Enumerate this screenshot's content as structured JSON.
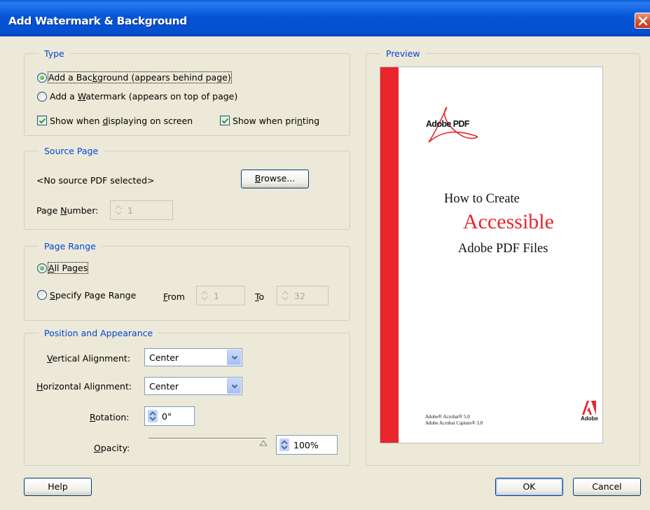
{
  "window": {
    "title": "Add Watermark & Background",
    "close_icon": "close-icon"
  },
  "type_group": {
    "legend": "Type",
    "radio_background": {
      "label_pre": "Add a Bac",
      "label_key": "k",
      "label_post": "ground (appears behind page)",
      "selected": true
    },
    "radio_watermark": {
      "label_pre": "Add a ",
      "label_key": "W",
      "label_post": "atermark (appears on top of page)",
      "selected": false
    },
    "check_screen": {
      "label_pre": "Show when ",
      "label_key": "d",
      "label_post": "isplaying on screen",
      "checked": true
    },
    "check_print": {
      "label_pre": "Show when pri",
      "label_key": "n",
      "label_post": "ting",
      "checked": true
    }
  },
  "source_group": {
    "legend": "Source Page",
    "status": "<No source PDF selected>",
    "browse": {
      "pre": "",
      "key": "B",
      "post": "rowse..."
    },
    "page_number": {
      "label_pre": "Page ",
      "label_key": "N",
      "label_post": "umber:",
      "value": "1"
    }
  },
  "range_group": {
    "legend": "Page Range",
    "all_pages": {
      "pre": "",
      "key": "A",
      "post": "ll Pages",
      "selected": true
    },
    "specify": {
      "pre": "",
      "key": "S",
      "post": "pecify Page Range",
      "selected": false
    },
    "from": {
      "key": "F",
      "post": "rom",
      "value": "1"
    },
    "to": {
      "key": "T",
      "post": "o",
      "value": "32"
    }
  },
  "position_group": {
    "legend": "Position and Appearance",
    "vertical": {
      "key": "V",
      "post": "ertical Alignment:",
      "value": "Center"
    },
    "horizontal": {
      "key": "H",
      "post": "orizontal Alignment:",
      "value": "Center"
    },
    "rotation": {
      "key": "R",
      "post": "otation:",
      "value": "0°"
    },
    "opacity": {
      "key": "O",
      "post": "pacity:",
      "value": "100%",
      "level": 1.0
    }
  },
  "preview": {
    "legend": "Preview",
    "logo_text": "Adobe PDF",
    "line1": "How to Create",
    "line2": "Accessible",
    "line3": "Adobe PDF Files",
    "footer1": "Adobe® Acrobat® 5.0",
    "footer2": "Adobe Acrobat Capture® 3.0",
    "brand": "Adobe",
    "accent": "#e8262b"
  },
  "buttons": {
    "help": "Help",
    "ok": "OK",
    "cancel": "Cancel"
  }
}
